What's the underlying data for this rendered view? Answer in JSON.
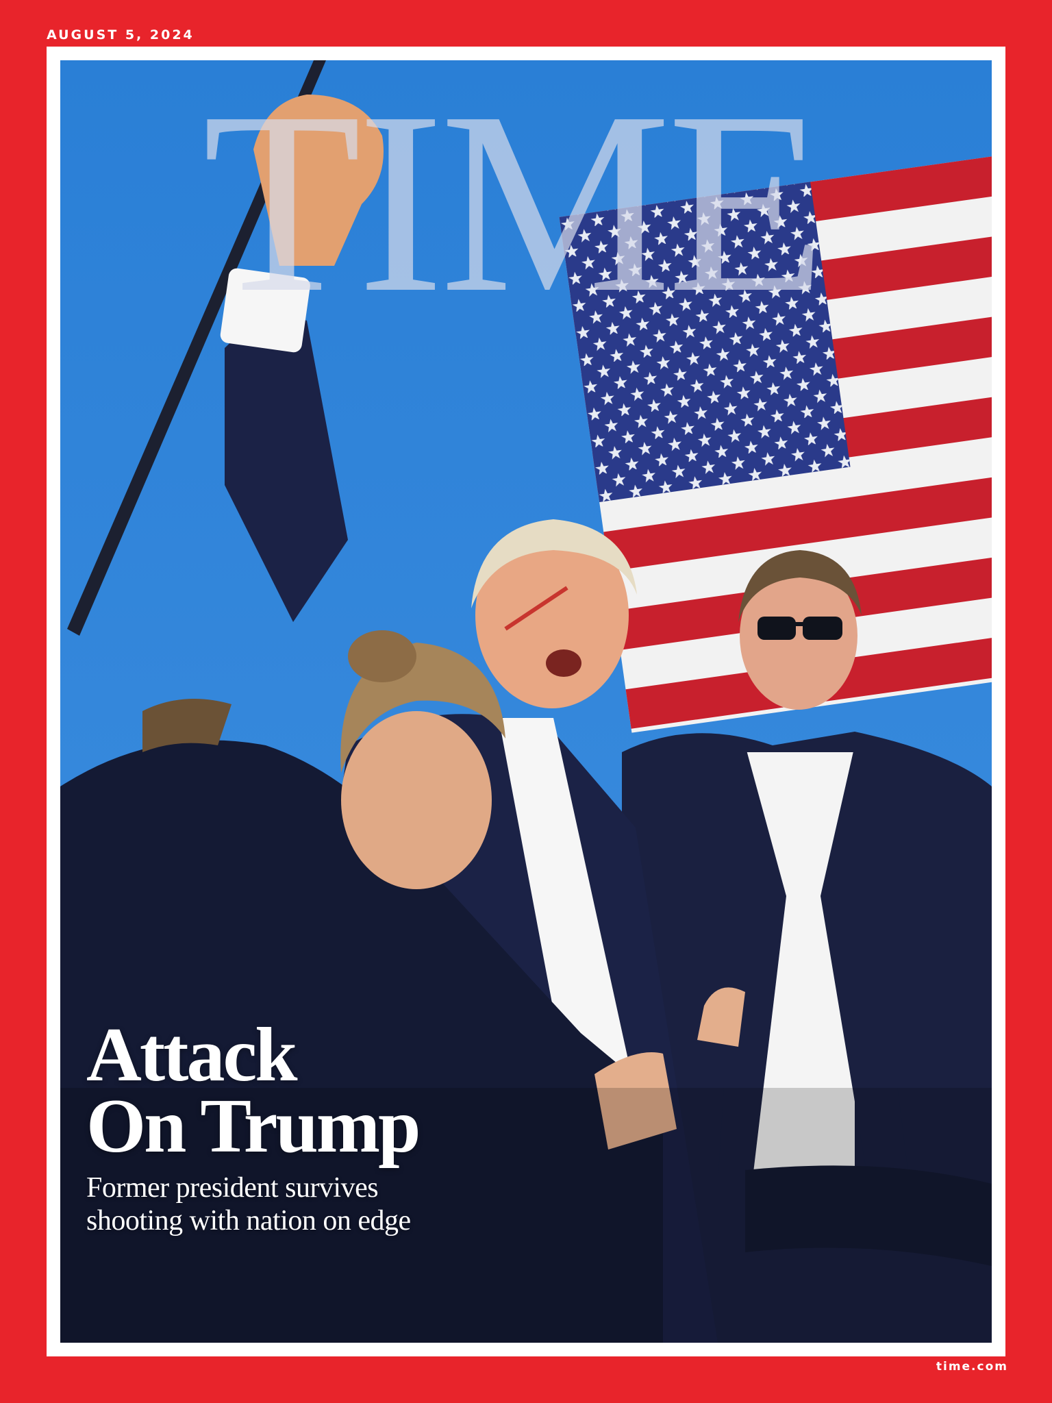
{
  "cover": {
    "issue_date": "AUGUST 5, 2024",
    "masthead": "TIME",
    "headline_line1": "Attack",
    "headline_line2": "On Trump",
    "dek_line1": "Former president survives",
    "dek_line2": "shooting with nation on edge",
    "site_url": "time.com"
  },
  "colors": {
    "border_red": "#e8242b",
    "sky_blue": "#2d82d8",
    "suit_navy": "#1a2040",
    "flag_red": "#c8202d",
    "flag_blue": "#2a3a8a"
  },
  "photo": {
    "subjects": [
      "raised-fist",
      "american-flag",
      "security-agent-left",
      "security-agent-right",
      "central-figure"
    ]
  }
}
